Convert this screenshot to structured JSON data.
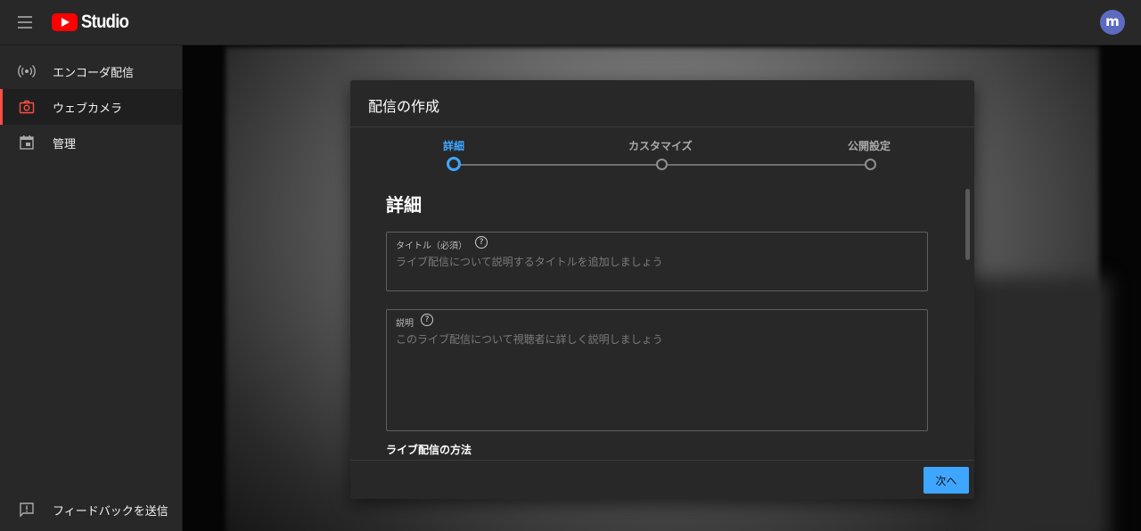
{
  "header": {
    "logo_text": "Studio",
    "avatar_letter": "m"
  },
  "sidebar": {
    "items": [
      {
        "label": "エンコーダ配信",
        "icon": "broadcast-icon",
        "active": false
      },
      {
        "label": "ウェブカメラ",
        "icon": "camera-icon",
        "active": true
      },
      {
        "label": "管理",
        "icon": "calendar-icon",
        "active": false
      }
    ],
    "feedback_label": "フィードバックを送信"
  },
  "dialog": {
    "title": "配信の作成",
    "steps": [
      {
        "label": "詳細",
        "active": true
      },
      {
        "label": "カスタマイズ",
        "active": false
      },
      {
        "label": "公開設定",
        "active": false
      }
    ],
    "section_title": "詳細",
    "title_field": {
      "label": "タイトル（必須）",
      "placeholder": "ライブ配信について説明するタイトルを追加しましょう"
    },
    "description_field": {
      "label": "説明",
      "placeholder": "このライブ配信について視聴者に詳しく説明しましょう"
    },
    "help_glyph": "?",
    "subheading": "ライブ配信の方法",
    "next_button": "次へ"
  },
  "colors": {
    "accent": "#3ea6ff",
    "active_indicator": "#ff4e45",
    "brand_red": "#ff0000",
    "avatar": "#5c6bc0"
  }
}
